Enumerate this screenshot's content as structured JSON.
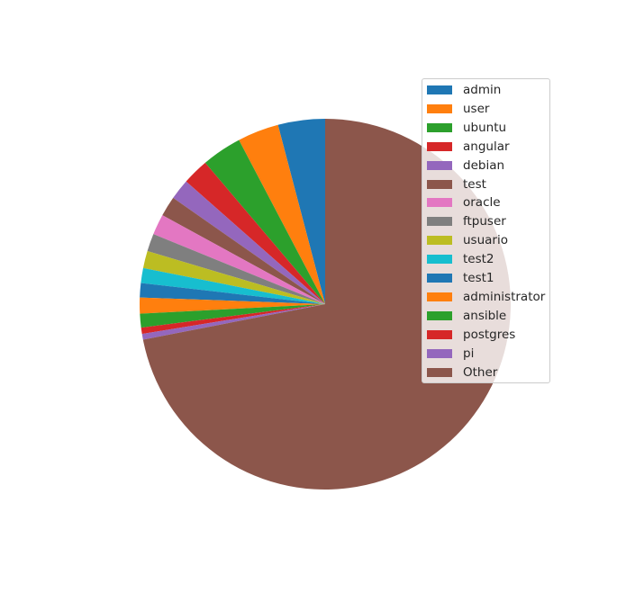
{
  "chart_data": {
    "type": "pie",
    "title": "",
    "start_angle_deg": 90,
    "direction": "counterclockwise",
    "legend_position": "upper-right",
    "slices": [
      {
        "label": "admin",
        "value": 4.1,
        "color": "#1f77b4"
      },
      {
        "label": "user",
        "value": 3.6,
        "color": "#ff7f0e"
      },
      {
        "label": "ubuntu",
        "value": 3.5,
        "color": "#2ca02c"
      },
      {
        "label": "angular",
        "value": 2.3,
        "color": "#d62728"
      },
      {
        "label": "debian",
        "value": 1.8,
        "color": "#9467bd"
      },
      {
        "label": "test",
        "value": 1.75,
        "color": "#8c564b"
      },
      {
        "label": "oracle",
        "value": 1.8,
        "color": "#e377c2"
      },
      {
        "label": "ftpuser",
        "value": 1.55,
        "color": "#7f7f7f"
      },
      {
        "label": "usuario",
        "value": 1.5,
        "color": "#bcbd22"
      },
      {
        "label": "test2",
        "value": 1.3,
        "color": "#17becf"
      },
      {
        "label": "test1",
        "value": 1.25,
        "color": "#1f77b4"
      },
      {
        "label": "administrator",
        "value": 1.4,
        "color": "#ff7f0e"
      },
      {
        "label": "ansible",
        "value": 1.2,
        "color": "#2ca02c"
      },
      {
        "label": "postgres",
        "value": 0.55,
        "color": "#d62728"
      },
      {
        "label": "pi",
        "value": 0.5,
        "color": "#9467bd"
      },
      {
        "label": "Other",
        "value": 72.0,
        "color": "#8c564b"
      }
    ]
  }
}
